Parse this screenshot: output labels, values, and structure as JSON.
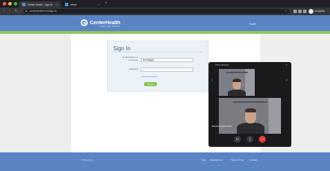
{
  "browser": {
    "tabs": [
      {
        "title": "Center Health - Sign In",
        "favicon_color": "#5a84c4"
      },
      {
        "title": "wheel",
        "favicon_color": "#4a90d9"
      }
    ],
    "url": "centerhealth.com/sign-in",
    "profile_label": "Incognito",
    "chrome_color": "#35363a"
  },
  "site": {
    "brand": "CenterHealth",
    "tagline": "Health made Personal",
    "header_link": "Home",
    "header_color": "#5a84c4",
    "accent_color": "#8fc45a"
  },
  "signin": {
    "title": "Sign In",
    "username_label": "Email Address or Username",
    "username_value": "bmcdagne",
    "password_label": "Password",
    "password_value": "",
    "forgot_link": "Forgot Password?",
    "submit_label": "Sign In"
  },
  "video_call": {
    "title": "Zoom Meeting",
    "participant_name": "Brandon Bentabin (Host)",
    "controls": [
      {
        "icon": "camera-icon",
        "color": "#3a3b3f"
      },
      {
        "icon": "microphone-icon",
        "color": "#3a3b3f"
      },
      {
        "icon": "end-call-icon",
        "color": "#e53935"
      }
    ]
  },
  "footer": {
    "copyright": "© 2021 Center",
    "links": [
      "FAQ",
      "Privacy Policy",
      "Terms of Use",
      "Contact"
    ]
  }
}
